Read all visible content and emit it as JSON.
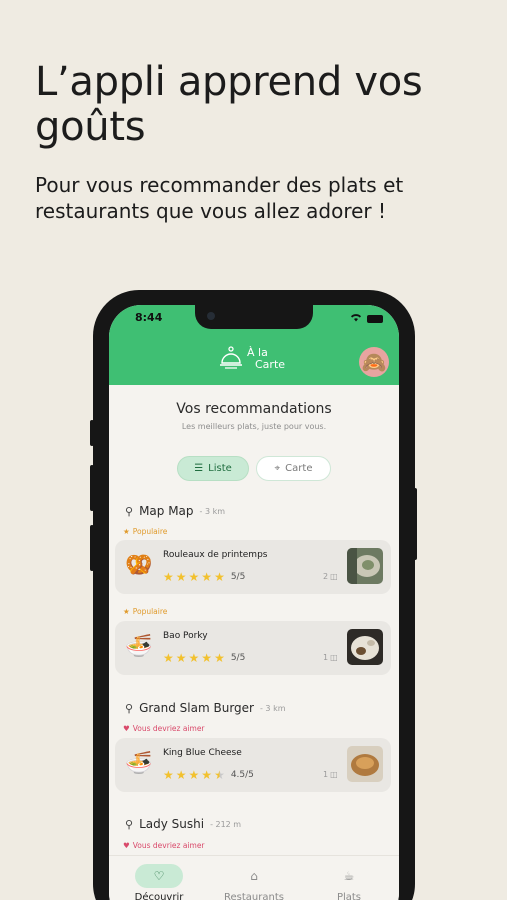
{
  "headline": "L’appli apprend vos goûts",
  "subline": "Pour vous recommander des plats et restaurants que vous allez adorer !",
  "status_bar": {
    "time": "8:44"
  },
  "app": {
    "logo_line1": "À la",
    "logo_line2": "Carte",
    "avatar_emoji": "🙈"
  },
  "recommendations": {
    "title": "Vos recommandations",
    "subtitle": "Les meilleurs plats, juste pour vous.",
    "view_list_label": "Liste",
    "view_map_label": "Carte"
  },
  "restaurants": [
    {
      "name": "Map Map",
      "distance": "- 3 km",
      "dishes": [
        {
          "tag": "Populaire",
          "tag_type": "popular",
          "name": "Rouleaux de printemps",
          "rating": 5,
          "score": "5/5",
          "photos": "2",
          "icon": "🥨"
        },
        {
          "tag": "Populaire",
          "tag_type": "popular",
          "name": "Bao Porky",
          "rating": 5,
          "score": "5/5",
          "photos": "1",
          "icon": "🍜"
        }
      ]
    },
    {
      "name": "Grand Slam Burger",
      "distance": "- 3 km",
      "dishes": [
        {
          "tag": "Vous devriez aimer",
          "tag_type": "like",
          "name": "King Blue Cheese",
          "rating": 4.5,
          "score": "4.5/5",
          "photos": "1",
          "icon": "🍜"
        }
      ]
    },
    {
      "name": "Lady Sushi",
      "distance": "- 212 m",
      "dishes": [
        {
          "tag": "Vous devriez aimer",
          "tag_type": "like"
        }
      ]
    }
  ],
  "tabs": [
    {
      "label": "Découvrir",
      "icon": "heart-icon",
      "active": true
    },
    {
      "label": "Restaurants",
      "icon": "home-icon",
      "active": false
    },
    {
      "label": "Plats",
      "icon": "dish-icon",
      "active": false
    }
  ],
  "colors": {
    "background": "#efebe2",
    "brand_green": "#3fbf73",
    "popular": "#e09b2d",
    "like": "#d94a6b",
    "star": "#f2c12e"
  }
}
